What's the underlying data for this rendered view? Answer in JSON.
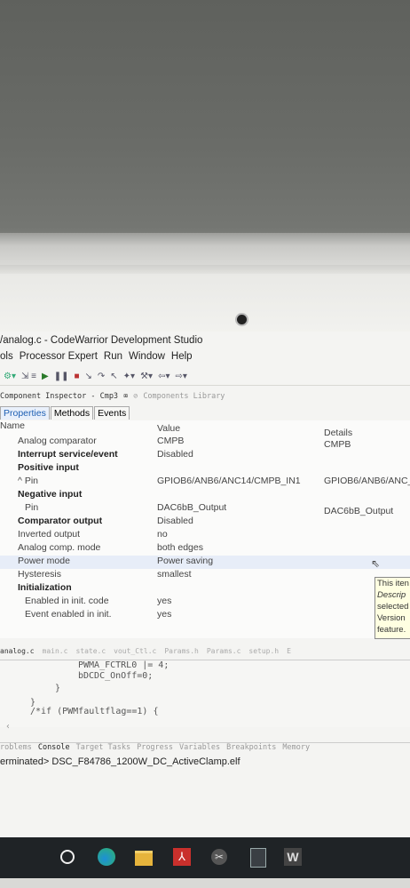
{
  "window": {
    "title": "/analog.c - CodeWarrior Development Studio",
    "menus": [
      "ols",
      "Processor Expert",
      "Run",
      "Window",
      "Help"
    ]
  },
  "view_tabs": {
    "inspector": "Component Inspector - Cmp3",
    "library": "Components Library"
  },
  "properties_tabs": [
    "Properties",
    "Methods",
    "Events"
  ],
  "grid": {
    "headers": {
      "name": "Name",
      "value": "Value",
      "details": "Details"
    },
    "rows": [
      {
        "name": "Analog comparator",
        "value": "CMPB",
        "details": "CMPB"
      },
      {
        "name": "Interrupt service/event",
        "value": "Disabled",
        "details": ""
      },
      {
        "name": "Positive input",
        "value": "",
        "details": ""
      },
      {
        "name": "^ Pin",
        "value": "GPIOB6/ANB6/ANC14/CMPB_IN1",
        "details": "GPIOB6/ANB6/ANC_"
      },
      {
        "name": "Negative input",
        "value": "",
        "details": ""
      },
      {
        "name": "Pin",
        "value": "DAC6bB_Output",
        "details": "DAC6bB_Output"
      },
      {
        "name": "Comparator output",
        "value": "Disabled",
        "details": ""
      },
      {
        "name": "Inverted output",
        "value": "no",
        "details": ""
      },
      {
        "name": "Analog comp. mode",
        "value": "both edges",
        "details": ""
      },
      {
        "name": "Power mode",
        "value": "Power saving",
        "details": ""
      },
      {
        "name": "Hysteresis",
        "value": "smallest",
        "details": ""
      },
      {
        "name": "Initialization",
        "value": "",
        "details": ""
      },
      {
        "name": "Enabled in init. code",
        "value": "yes",
        "details": ""
      },
      {
        "name": "Event enabled in init.",
        "value": "yes",
        "details": ""
      }
    ]
  },
  "tooltip": [
    "This iten",
    "Descrip",
    "selected",
    "Version",
    "feature."
  ],
  "editor_tabs": [
    "analog.c",
    "main.c",
    "state.c",
    "vout_Ctl.c",
    "Params.h",
    "Params.c",
    "setup.h",
    "E"
  ],
  "code_lines": [
    "PWMA_FCTRL0 |= 4;",
    "bDCDC_OnOff=0;",
    "}",
    "}",
    "/*if (PWMfaultflag==1) {"
  ],
  "console_tabs": [
    "roblems",
    "Console",
    "Target Tasks",
    "Progress",
    "Variables",
    "Breakpoints",
    "Memory"
  ],
  "console_status": "erminated> DSC_F84786_1200W_DC_ActiveClamp.elf",
  "taskbar_icons": [
    "cortana-circle-icon",
    "edge-browser-icon",
    "file-explorer-icon",
    "acrobat-icon",
    "snipping-tool-icon",
    "calculator-icon",
    "word-icon"
  ],
  "colors": {
    "accent_blue": "#1d5fb3",
    "taskbar": "#1f2326",
    "tooltip": "#ffffe1",
    "highlight_row": "#e7edf8"
  }
}
